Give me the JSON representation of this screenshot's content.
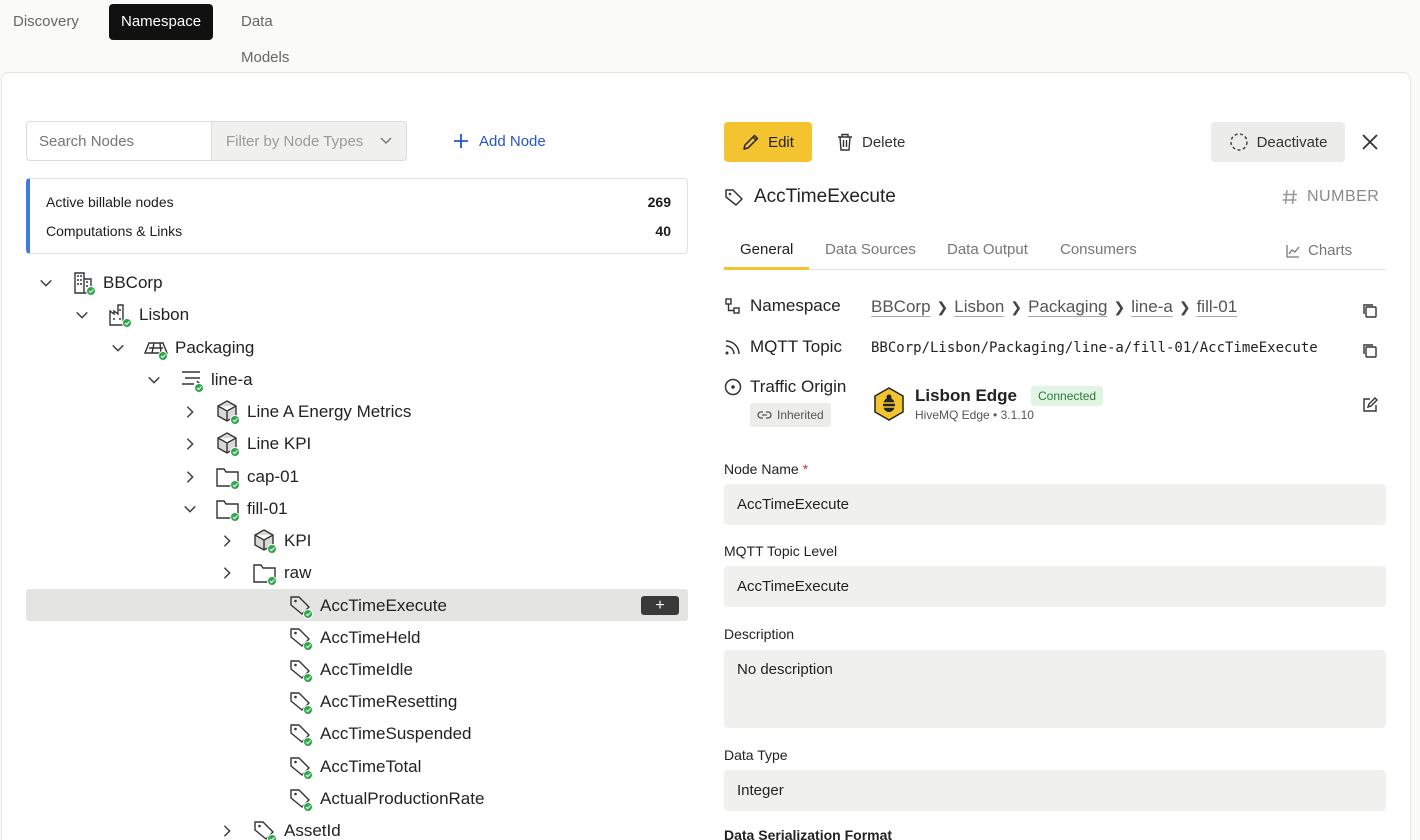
{
  "topnav": {
    "tabs": [
      "Discovery",
      "Namespace",
      "Data Models"
    ],
    "active": "Namespace"
  },
  "toolbar": {
    "search_placeholder": "Search Nodes",
    "filter_placeholder": "Filter by Node Types",
    "add_node_label": "Add Node"
  },
  "stats": [
    {
      "label": "Active billable nodes",
      "value": "269"
    },
    {
      "label": "Computations & Links",
      "value": "40"
    }
  ],
  "tree": [
    {
      "label": "BBCorp",
      "icon": "enterprise-icon",
      "expanded": true
    },
    {
      "label": "Lisbon",
      "icon": "site-icon",
      "expanded": true
    },
    {
      "label": "Packaging",
      "icon": "area-icon",
      "expanded": true
    },
    {
      "label": "line-a",
      "icon": "line-icon",
      "expanded": true
    },
    {
      "label": "Line A Energy Metrics",
      "icon": "cube-icon",
      "expanded": false
    },
    {
      "label": "Line KPI",
      "icon": "cube-icon",
      "expanded": false
    },
    {
      "label": "cap-01",
      "icon": "folder-icon",
      "expanded": false
    },
    {
      "label": "fill-01",
      "icon": "folder-icon",
      "expanded": true
    },
    {
      "label": "KPI",
      "icon": "cube-icon",
      "expanded": false
    },
    {
      "label": "raw",
      "icon": "folder-icon",
      "expanded": false
    },
    {
      "label": "AccTimeExecute",
      "icon": "tag-icon",
      "selected": true
    },
    {
      "label": "AccTimeHeld",
      "icon": "tag-icon"
    },
    {
      "label": "AccTimeIdle",
      "icon": "tag-icon"
    },
    {
      "label": "AccTimeResetting",
      "icon": "tag-icon"
    },
    {
      "label": "AccTimeSuspended",
      "icon": "tag-icon"
    },
    {
      "label": "AccTimeTotal",
      "icon": "tag-icon"
    },
    {
      "label": "ActualProductionRate",
      "icon": "tag-icon"
    },
    {
      "label": "AssetId",
      "icon": "tag-icon",
      "expanded": false
    }
  ],
  "tree_add_button": "+",
  "actions": {
    "edit": "Edit",
    "delete": "Delete",
    "deactivate": "Deactivate"
  },
  "node": {
    "title": "AccTimeExecute",
    "type_badge": "NUMBER",
    "tabs": [
      "General",
      "Data Sources",
      "Data Output",
      "Consumers"
    ],
    "charts_tab": "Charts",
    "active_tab": "General"
  },
  "props": {
    "namespace_label": "Namespace",
    "namespace_path": [
      "BBCorp",
      "Lisbon",
      "Packaging",
      "line-a",
      "fill-01"
    ],
    "mqtt_label": "MQTT Topic",
    "mqtt_topic": "BBCorp/Lisbon/Packaging/line-a/fill-01/AccTimeExecute",
    "origin_label": "Traffic Origin",
    "inherited": "Inherited",
    "edge_name": "Lisbon Edge",
    "edge_status": "Connected",
    "edge_sub": "HiveMQ Edge • 3.1.10"
  },
  "form": {
    "name_label": "Node Name",
    "name_required": "*",
    "name_value": "AccTimeExecute",
    "topic_label": "MQTT Topic Level",
    "topic_value": "AccTimeExecute",
    "desc_label": "Description",
    "desc_value": "No description",
    "dtype_label": "Data Type",
    "dtype_value": "Integer",
    "serial_label": "Data Serialization Format"
  },
  "colors": {
    "accent": "#f4c430",
    "link": "#2456c8",
    "status_ok": "#2aa84a",
    "stats_bar": "#3b7ce0"
  }
}
